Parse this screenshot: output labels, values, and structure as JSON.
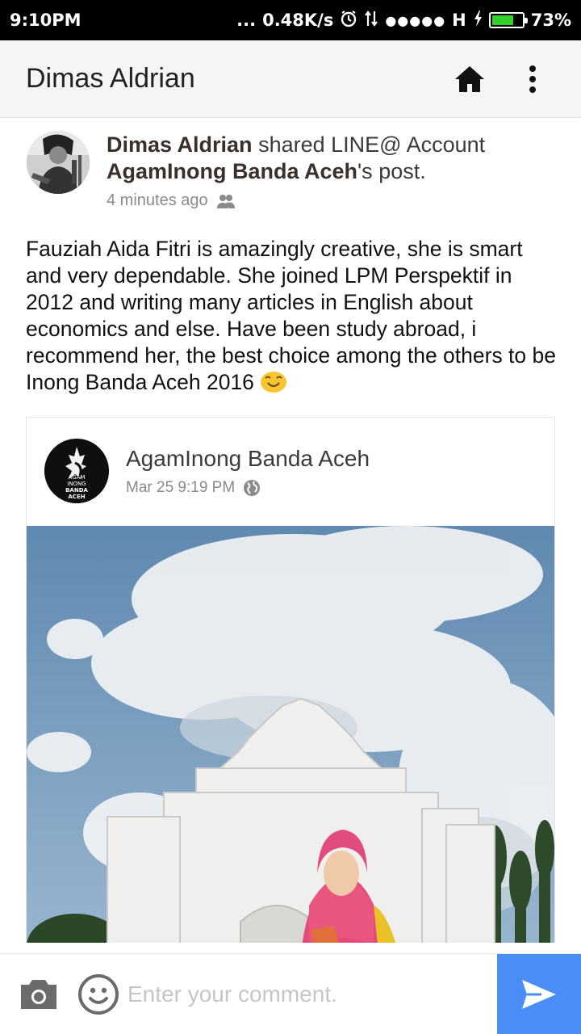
{
  "status_bar": {
    "time": "9:10PM",
    "dots": "...",
    "net_speed": "0.48K/s",
    "signal_dots": "●●●●●",
    "network_type": "H",
    "battery_percent": "73%",
    "battery_level": 0.73
  },
  "app_bar": {
    "title": "Dimas Aldrian",
    "home_icon": "home-icon",
    "menu_icon": "more-vertical-icon"
  },
  "post": {
    "author": "Dimas Aldrian",
    "shared_text": " shared LINE@ Account ",
    "shared_account": "AgamInong Banda Aceh",
    "suffix": "'s post.",
    "time": "4 minutes ago",
    "privacy_icon": "friends-icon",
    "body": "Fauziah Aida Fitri is amazingly creative, she is smart and very dependable. She joined LPM Perspektif in 2012 and writing many articles in English about economics and else. Have been study abroad, i recommend her, the best choice among the others to be Inong Banda Aceh 2016",
    "emoji": "smiling-face-emoji"
  },
  "shared_post": {
    "account_name": "AgamInong Banda Aceh",
    "logo_line1": "AGAM",
    "logo_line2": "INONG",
    "logo_line3": "BANDA",
    "logo_line4": "ACEH",
    "timestamp": "Mar 25 9:19 PM",
    "privacy_icon": "globe-icon"
  },
  "comment_bar": {
    "placeholder": "Enter your comment.",
    "camera_icon": "camera-icon",
    "emoji_icon": "smiley-icon",
    "send_icon": "send-icon",
    "send_color": "#4a8ef5"
  }
}
